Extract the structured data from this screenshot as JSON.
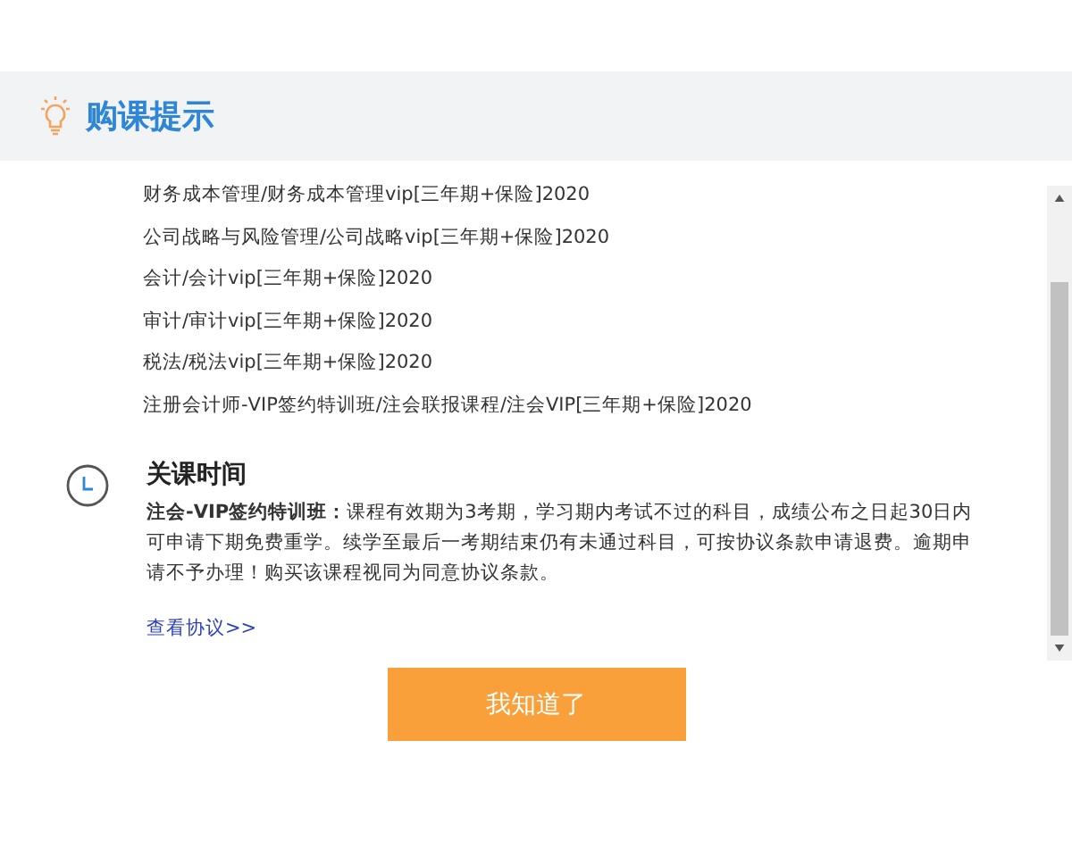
{
  "header": {
    "title": "购课提示"
  },
  "courses": [
    "财务成本管理/财务成本管理vip[三年期+保险]2020",
    "公司战略与风险管理/公司战略vip[三年期+保险]2020",
    "会计/会计vip[三年期+保险]2020",
    "审计/审计vip[三年期+保险]2020",
    "税法/税法vip[三年期+保险]2020",
    "注册会计师-VIP签约特训班/注会联报课程/注会VIP[三年期+保险]2020"
  ],
  "closing": {
    "title": "关课时间",
    "text": "**注会-VIP签约特训班：**课程有效期为3考期，学习期内考试不过的科目，成绩公布之日起30日内可申请下期免费重学。续学至最后一考期结束仍有未通过科目，可按协议条款申请退费。逾期申请不予办理！购买该课程视同为同意协议条款。",
    "link": "查看协议>>"
  },
  "button": "我知道了"
}
